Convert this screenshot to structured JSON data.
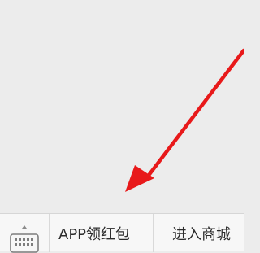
{
  "bottom_menu": {
    "keyboard_toggle_icon": "keyboard-icon",
    "items": [
      {
        "label": "APP领红包"
      },
      {
        "label": "进入商城"
      }
    ]
  },
  "annotation": {
    "arrow_color": "#e8191a",
    "icon": "arrow-icon"
  }
}
